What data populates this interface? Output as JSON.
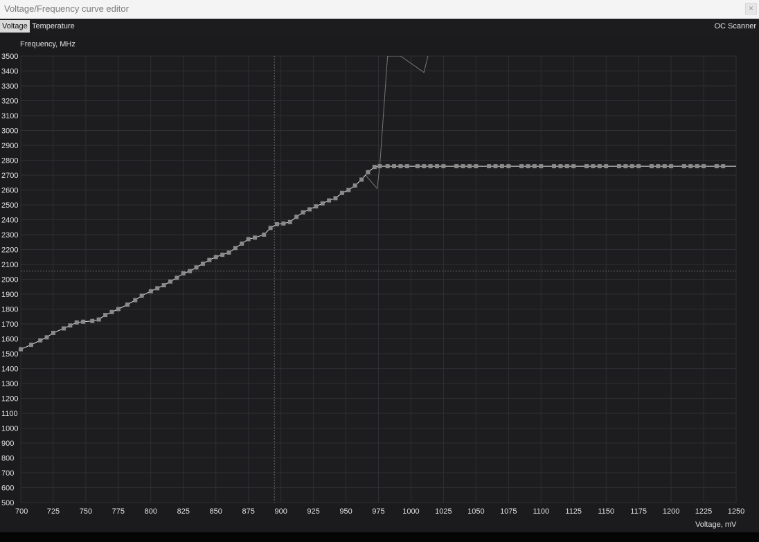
{
  "window": {
    "title": "Voltage/Frequency curve editor",
    "close_icon": "close-icon"
  },
  "tabs": [
    {
      "label": "Voltage",
      "active": true
    },
    {
      "label": "Temperature",
      "active": false
    }
  ],
  "oc_scanner_label": "OC Scanner",
  "chart_data": {
    "type": "line",
    "title": "",
    "ylabel": "Frequency, MHz",
    "xlabel": "Voltage, mV",
    "xlim": [
      700,
      1250
    ],
    "ylim": [
      500,
      3500
    ],
    "xticks": [
      700,
      725,
      750,
      775,
      800,
      825,
      850,
      875,
      900,
      925,
      950,
      975,
      1000,
      1025,
      1050,
      1075,
      1100,
      1125,
      1150,
      1175,
      1200,
      1225,
      1250
    ],
    "yticks": [
      500,
      600,
      700,
      800,
      900,
      1000,
      1100,
      1200,
      1300,
      1400,
      1500,
      1600,
      1700,
      1800,
      1900,
      2000,
      2100,
      2200,
      2300,
      2400,
      2500,
      2600,
      2700,
      2800,
      2900,
      3000,
      3100,
      3200,
      3300,
      3400,
      3500
    ],
    "grid": true,
    "crosshair": {
      "x": 895,
      "y": 2055
    },
    "series": [
      {
        "role": "curve",
        "color": "#e6e6e6",
        "marker_color": "#8a8a8a",
        "x": [
          700,
          708,
          715,
          720,
          725,
          733,
          738,
          743,
          748,
          755,
          760,
          765,
          770,
          775,
          782,
          788,
          793,
          800,
          805,
          810,
          815,
          820,
          825,
          830,
          835,
          840,
          845,
          850,
          855,
          860,
          865,
          870,
          875,
          880,
          887,
          892,
          897,
          902,
          907,
          912,
          917,
          922,
          927,
          932,
          937,
          942,
          947,
          952,
          957,
          962,
          967,
          972,
          976,
          982,
          987,
          992,
          997,
          1005,
          1010,
          1015,
          1020,
          1025,
          1035,
          1040,
          1045,
          1050,
          1060,
          1065,
          1070,
          1075,
          1085,
          1090,
          1095,
          1100,
          1110,
          1115,
          1120,
          1125,
          1135,
          1140,
          1145,
          1150,
          1160,
          1165,
          1170,
          1175,
          1185,
          1190,
          1195,
          1200,
          1210,
          1215,
          1220,
          1225,
          1235,
          1240,
          1250
        ],
        "y": [
          1530,
          1560,
          1590,
          1610,
          1640,
          1670,
          1690,
          1710,
          1715,
          1720,
          1730,
          1760,
          1780,
          1800,
          1830,
          1860,
          1890,
          1920,
          1940,
          1960,
          1985,
          2010,
          2040,
          2055,
          2080,
          2105,
          2130,
          2150,
          2165,
          2180,
          2210,
          2240,
          2270,
          2280,
          2300,
          2345,
          2370,
          2375,
          2385,
          2420,
          2450,
          2470,
          2490,
          2510,
          2530,
          2545,
          2580,
          2600,
          2630,
          2670,
          2720,
          2755,
          2760,
          2760,
          2760,
          2760,
          2760,
          2760,
          2760,
          2760,
          2760,
          2760,
          2760,
          2760,
          2760,
          2760,
          2760,
          2760,
          2760,
          2760,
          2760,
          2760,
          2760,
          2760,
          2760,
          2760,
          2760,
          2760,
          2760,
          2760,
          2760,
          2760,
          2760,
          2760,
          2760,
          2760,
          2760,
          2760,
          2760,
          2760,
          2760,
          2760,
          2760,
          2760,
          2760,
          2760,
          2760
        ]
      },
      {
        "role": "spike",
        "color": "#777777",
        "x": [
          965,
          974,
          976,
          982,
          992,
          1010,
          1013
        ],
        "y": [
          2700,
          2610,
          2760,
          3500,
          3500,
          3390,
          3500
        ]
      }
    ]
  }
}
